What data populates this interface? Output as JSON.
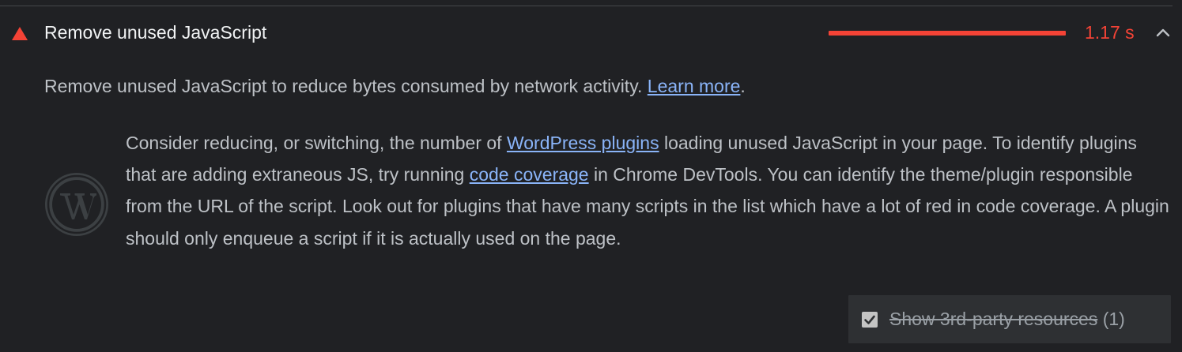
{
  "audit": {
    "title": "Remove unused JavaScript",
    "status": "fail",
    "savings_value": "1.17 s",
    "savings_fraction": 1.0,
    "expanded": true,
    "status_color": "#f44336"
  },
  "description": {
    "text": "Remove unused JavaScript to reduce bytes consumed by network activity. ",
    "link_label": "Learn more",
    "suffix": "."
  },
  "stack_pack": {
    "icon": "wordpress-icon",
    "text_1": "Consider reducing, or switching, the number of ",
    "link_1": "WordPress plugins",
    "text_2": " loading unused JavaScript in your page. To identify plugins that are adding extraneous JS, try running ",
    "link_2": "code coverage",
    "text_3": " in Chrome DevTools. You can identify the theme/plugin responsible from the URL of the script. Look out for plugins that have many scripts in the list which have a lot of red in code coverage. A plugin should only enqueue a script if it is actually used on the page."
  },
  "third_party": {
    "label": "Show 3rd-party resources",
    "count": "(1)",
    "checked": true
  },
  "colors": {
    "background": "#202124",
    "link": "#8ab4f8",
    "fail": "#f44336"
  }
}
